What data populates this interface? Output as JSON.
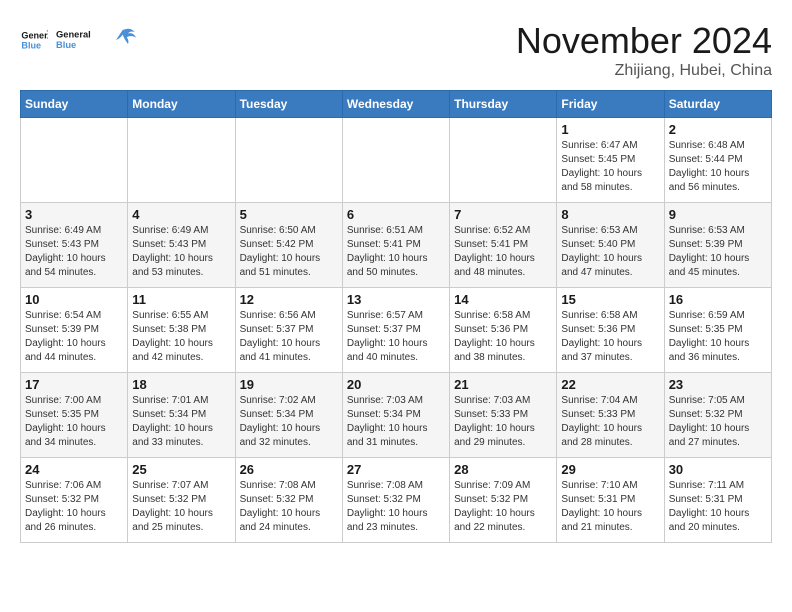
{
  "logo": {
    "line1": "General",
    "line2": "Blue"
  },
  "header": {
    "month": "November 2024",
    "location": "Zhijiang, Hubei, China"
  },
  "weekdays": [
    "Sunday",
    "Monday",
    "Tuesday",
    "Wednesday",
    "Thursday",
    "Friday",
    "Saturday"
  ],
  "weeks": [
    [
      {
        "day": "",
        "info": ""
      },
      {
        "day": "",
        "info": ""
      },
      {
        "day": "",
        "info": ""
      },
      {
        "day": "",
        "info": ""
      },
      {
        "day": "",
        "info": ""
      },
      {
        "day": "1",
        "info": "Sunrise: 6:47 AM\nSunset: 5:45 PM\nDaylight: 10 hours and 58 minutes."
      },
      {
        "day": "2",
        "info": "Sunrise: 6:48 AM\nSunset: 5:44 PM\nDaylight: 10 hours and 56 minutes."
      }
    ],
    [
      {
        "day": "3",
        "info": "Sunrise: 6:49 AM\nSunset: 5:43 PM\nDaylight: 10 hours and 54 minutes."
      },
      {
        "day": "4",
        "info": "Sunrise: 6:49 AM\nSunset: 5:43 PM\nDaylight: 10 hours and 53 minutes."
      },
      {
        "day": "5",
        "info": "Sunrise: 6:50 AM\nSunset: 5:42 PM\nDaylight: 10 hours and 51 minutes."
      },
      {
        "day": "6",
        "info": "Sunrise: 6:51 AM\nSunset: 5:41 PM\nDaylight: 10 hours and 50 minutes."
      },
      {
        "day": "7",
        "info": "Sunrise: 6:52 AM\nSunset: 5:41 PM\nDaylight: 10 hours and 48 minutes."
      },
      {
        "day": "8",
        "info": "Sunrise: 6:53 AM\nSunset: 5:40 PM\nDaylight: 10 hours and 47 minutes."
      },
      {
        "day": "9",
        "info": "Sunrise: 6:53 AM\nSunset: 5:39 PM\nDaylight: 10 hours and 45 minutes."
      }
    ],
    [
      {
        "day": "10",
        "info": "Sunrise: 6:54 AM\nSunset: 5:39 PM\nDaylight: 10 hours and 44 minutes."
      },
      {
        "day": "11",
        "info": "Sunrise: 6:55 AM\nSunset: 5:38 PM\nDaylight: 10 hours and 42 minutes."
      },
      {
        "day": "12",
        "info": "Sunrise: 6:56 AM\nSunset: 5:37 PM\nDaylight: 10 hours and 41 minutes."
      },
      {
        "day": "13",
        "info": "Sunrise: 6:57 AM\nSunset: 5:37 PM\nDaylight: 10 hours and 40 minutes."
      },
      {
        "day": "14",
        "info": "Sunrise: 6:58 AM\nSunset: 5:36 PM\nDaylight: 10 hours and 38 minutes."
      },
      {
        "day": "15",
        "info": "Sunrise: 6:58 AM\nSunset: 5:36 PM\nDaylight: 10 hours and 37 minutes."
      },
      {
        "day": "16",
        "info": "Sunrise: 6:59 AM\nSunset: 5:35 PM\nDaylight: 10 hours and 36 minutes."
      }
    ],
    [
      {
        "day": "17",
        "info": "Sunrise: 7:00 AM\nSunset: 5:35 PM\nDaylight: 10 hours and 34 minutes."
      },
      {
        "day": "18",
        "info": "Sunrise: 7:01 AM\nSunset: 5:34 PM\nDaylight: 10 hours and 33 minutes."
      },
      {
        "day": "19",
        "info": "Sunrise: 7:02 AM\nSunset: 5:34 PM\nDaylight: 10 hours and 32 minutes."
      },
      {
        "day": "20",
        "info": "Sunrise: 7:03 AM\nSunset: 5:34 PM\nDaylight: 10 hours and 31 minutes."
      },
      {
        "day": "21",
        "info": "Sunrise: 7:03 AM\nSunset: 5:33 PM\nDaylight: 10 hours and 29 minutes."
      },
      {
        "day": "22",
        "info": "Sunrise: 7:04 AM\nSunset: 5:33 PM\nDaylight: 10 hours and 28 minutes."
      },
      {
        "day": "23",
        "info": "Sunrise: 7:05 AM\nSunset: 5:32 PM\nDaylight: 10 hours and 27 minutes."
      }
    ],
    [
      {
        "day": "24",
        "info": "Sunrise: 7:06 AM\nSunset: 5:32 PM\nDaylight: 10 hours and 26 minutes."
      },
      {
        "day": "25",
        "info": "Sunrise: 7:07 AM\nSunset: 5:32 PM\nDaylight: 10 hours and 25 minutes."
      },
      {
        "day": "26",
        "info": "Sunrise: 7:08 AM\nSunset: 5:32 PM\nDaylight: 10 hours and 24 minutes."
      },
      {
        "day": "27",
        "info": "Sunrise: 7:08 AM\nSunset: 5:32 PM\nDaylight: 10 hours and 23 minutes."
      },
      {
        "day": "28",
        "info": "Sunrise: 7:09 AM\nSunset: 5:32 PM\nDaylight: 10 hours and 22 minutes."
      },
      {
        "day": "29",
        "info": "Sunrise: 7:10 AM\nSunset: 5:31 PM\nDaylight: 10 hours and 21 minutes."
      },
      {
        "day": "30",
        "info": "Sunrise: 7:11 AM\nSunset: 5:31 PM\nDaylight: 10 hours and 20 minutes."
      }
    ]
  ]
}
